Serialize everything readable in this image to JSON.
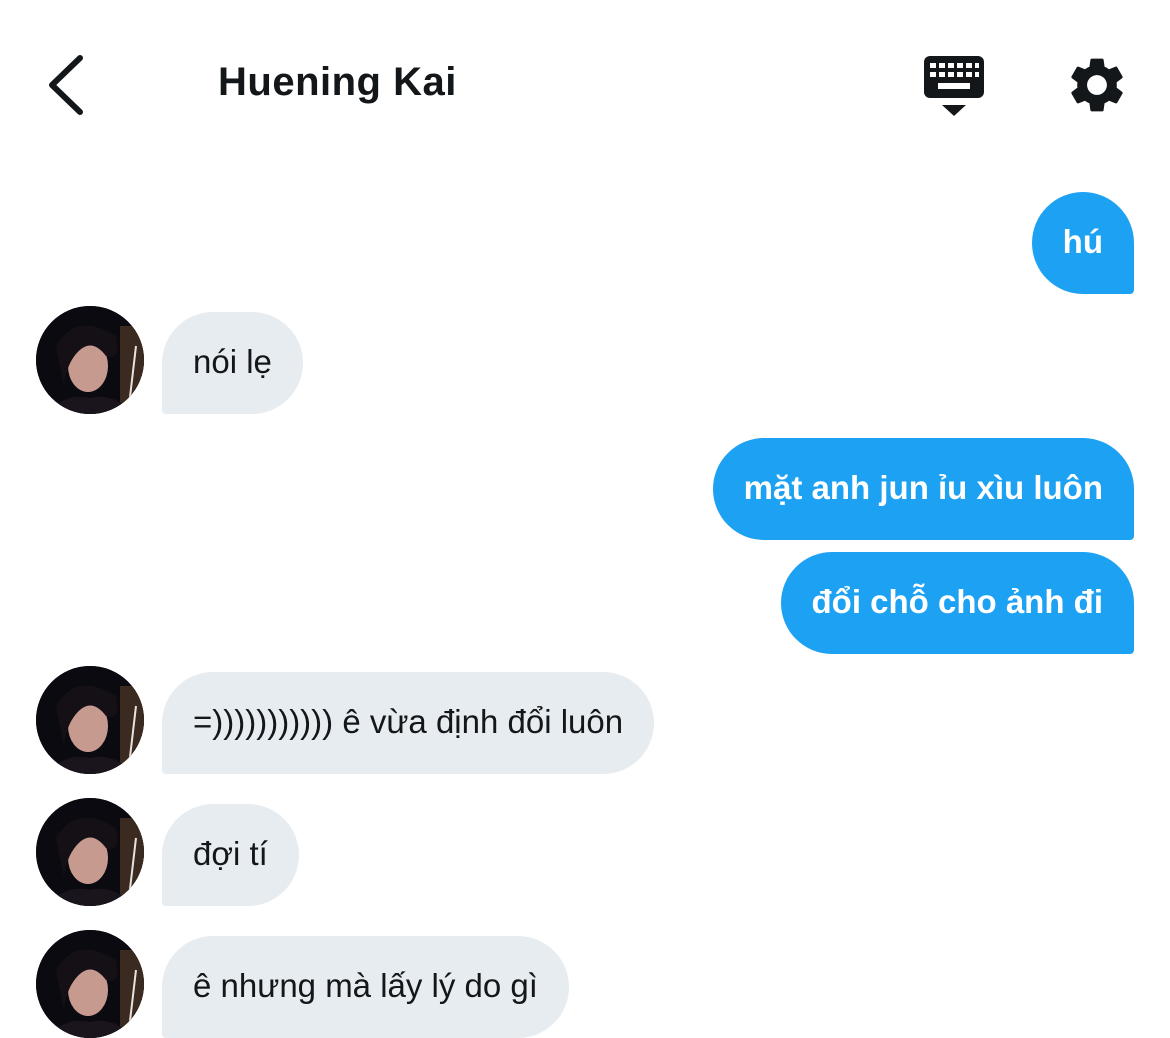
{
  "header": {
    "title": "Huening Kai",
    "back_icon": "chevron-left-icon",
    "keyboard_icon": "keyboard-dismiss-icon",
    "settings_icon": "gear-icon"
  },
  "messages": [
    {
      "side": "sent",
      "text": "hú"
    },
    {
      "side": "received",
      "text": "nói lẹ"
    },
    {
      "side": "sent",
      "text": "mặt anh jun ỉu xìu luôn"
    },
    {
      "side": "sent",
      "text": "đổi chỗ cho ảnh đi"
    },
    {
      "side": "received",
      "text": "=))))))))))) ê vừa định đổi luôn"
    },
    {
      "side": "received",
      "text": "đợi tí"
    },
    {
      "side": "received",
      "text": "ê nhưng mà lấy lý do gì"
    }
  ],
  "colors": {
    "sent_bubble": "#1da1f2",
    "received_bubble": "#e6ecf0",
    "text_dark": "#14171a"
  }
}
